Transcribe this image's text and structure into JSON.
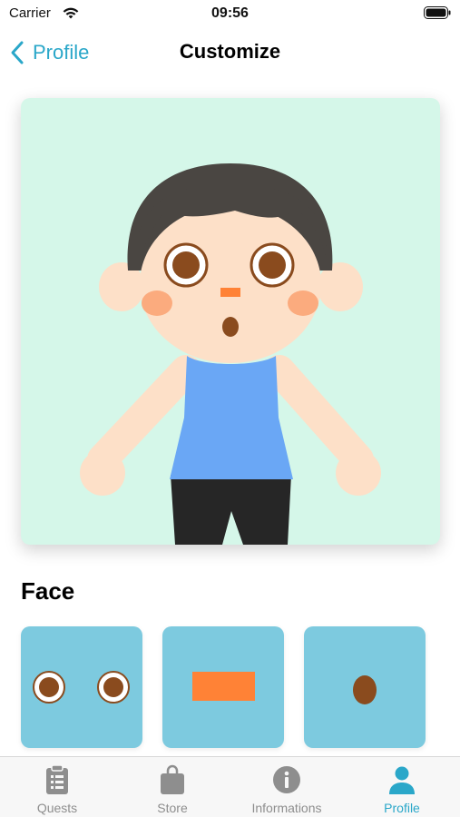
{
  "status_bar": {
    "carrier": "Carrier",
    "time": "09:56"
  },
  "nav": {
    "back_label": "Profile",
    "title": "Customize"
  },
  "section": {
    "title": "Face"
  },
  "face_items": [
    {
      "icon": "eyes-icon"
    },
    {
      "icon": "nose-icon"
    },
    {
      "icon": "mouth-icon"
    }
  ],
  "tabs": [
    {
      "label": "Quests",
      "icon": "clipboard-icon",
      "active": false
    },
    {
      "label": "Store",
      "icon": "shopping-bag-icon",
      "active": false
    },
    {
      "label": "Informations",
      "icon": "info-icon",
      "active": false
    },
    {
      "label": "Profile",
      "icon": "person-icon",
      "active": true
    }
  ],
  "colors": {
    "accent": "#2aa7c9",
    "avatar_background": "#d5f7e9",
    "face_item_background": "#7dcadf",
    "skin": "#fde0c8",
    "hair": "#4a4642",
    "shirt": "#6aa7f5",
    "pants": "#262626",
    "eye": "#8a4b1e",
    "nose": "#ff8236",
    "cheek": "#fbab7e"
  }
}
